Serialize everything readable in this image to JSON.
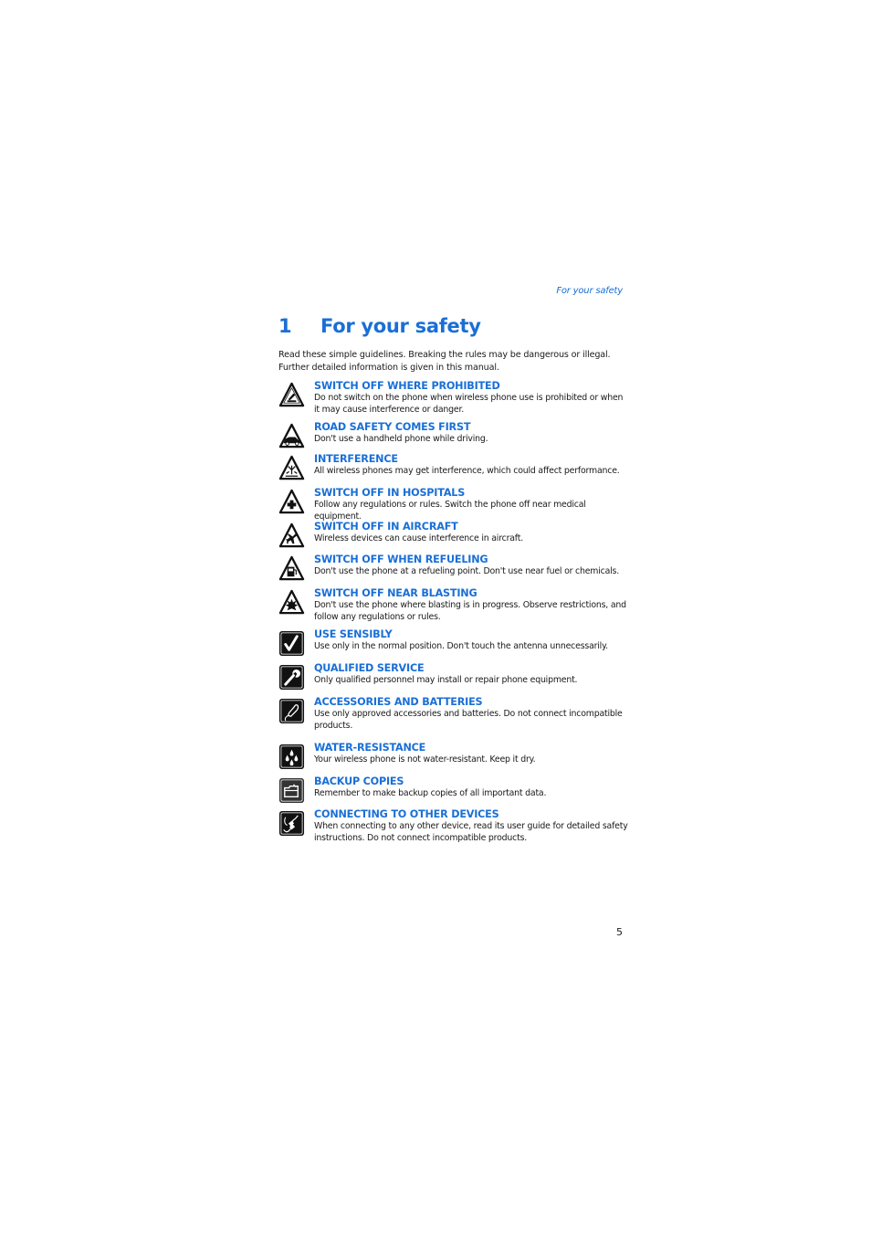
{
  "header": {
    "running_title": "For your safety"
  },
  "chapter": {
    "number": "1",
    "title": "For your safety"
  },
  "intro": "Read these simple guidelines. Breaking the rules may be dangerous or illegal. Further detailed information is given in this manual.",
  "items": [
    {
      "icon": "no-phone-warning-icon",
      "heading": "SWITCH OFF WHERE PROHIBITED",
      "description": "Do not switch on the phone when wireless phone use is prohibited or when it may cause interference or danger."
    },
    {
      "icon": "car-warning-icon",
      "heading": "ROAD SAFETY COMES FIRST",
      "description": "Don't use a handheld phone while driving."
    },
    {
      "icon": "interference-warning-icon",
      "heading": "INTERFERENCE",
      "description": "All wireless phones may get interference, which could affect performance."
    },
    {
      "icon": "hospital-cross-warning-icon",
      "heading": "SWITCH OFF IN HOSPITALS",
      "description": "Follow any regulations or rules. Switch the phone off near medical equipment."
    },
    {
      "icon": "aircraft-warning-icon",
      "heading": "SWITCH OFF IN AIRCRAFT",
      "description": "Wireless devices can cause interference in aircraft."
    },
    {
      "icon": "fuel-pump-warning-icon",
      "heading": "SWITCH OFF WHEN REFUELING",
      "description": "Don't use the phone at a refueling point. Don't use near fuel or chemicals."
    },
    {
      "icon": "blasting-warning-icon",
      "heading": "SWITCH OFF NEAR BLASTING",
      "description": "Don't use the phone where blasting is in progress. Observe restrictions, and follow any regulations or rules."
    },
    {
      "icon": "checkmark-icon",
      "heading": "USE SENSIBLY",
      "description": "Use only in the normal position. Don't touch the antenna unnecessarily."
    },
    {
      "icon": "wrench-icon",
      "heading": "QUALIFIED SERVICE",
      "description": "Only qualified personnel may install or repair phone equipment."
    },
    {
      "icon": "accessory-plug-icon",
      "heading": "ACCESSORIES AND BATTERIES",
      "description": "Use only approved accessories and batteries. Do not connect incompatible products."
    },
    {
      "icon": "water-drops-icon",
      "heading": "WATER-RESISTANCE",
      "description": "Your wireless phone is not water-resistant. Keep it dry."
    },
    {
      "icon": "backup-folder-icon",
      "heading": "BACKUP COPIES",
      "description": "Remember to make backup copies of all important data."
    },
    {
      "icon": "connector-cables-icon",
      "heading": "CONNECTING TO OTHER DEVICES",
      "description": "When connecting to any other device, read its user guide for detailed safety instructions. Do not connect incompatible products."
    }
  ],
  "footer": {
    "page_number": "5"
  }
}
